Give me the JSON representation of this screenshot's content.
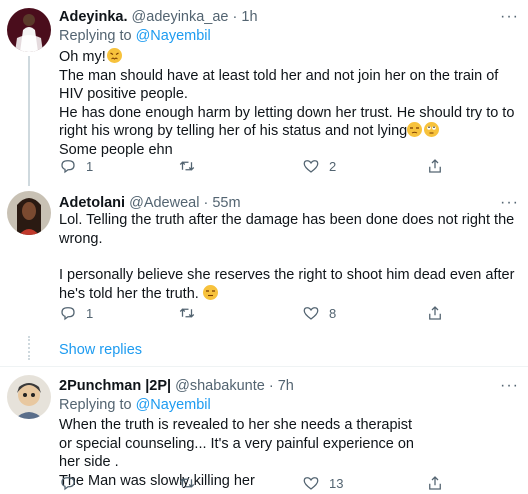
{
  "tweets": [
    {
      "name": "Adeyinka.",
      "handle": "@adeyinka_ae",
      "time": "1h",
      "reply_prefix": "Replying to",
      "reply_to": "@Nayembil",
      "lines": [
        "Oh my!",
        "The man should have at least told her and not join her on the train of HIV positive people.",
        "He has done enough harm by letting down her trust. He should try to to right his wrong by telling her of his status and not lying",
        "Some people ehn"
      ],
      "replies": "1",
      "retweets": "",
      "likes": "2",
      "avatar_icon": "profile-photo-woman-white-dress",
      "emoji": [
        "confounded-face-emoji",
        "unamused-face-emoji",
        "face-with-rolling-eyes-emoji"
      ]
    },
    {
      "name": "Adetolani",
      "handle": "@Adeweal",
      "time": "55m",
      "lines": [
        "Lol. Telling the truth after the damage has been done does not right the wrong.",
        "I personally believe she reserves the right to shoot him dead even after he's told her the truth."
      ],
      "replies": "1",
      "retweets": "",
      "likes": "8",
      "avatar_icon": "profile-photo-woman-braids",
      "emoji": [
        "expressionless-face-emoji"
      ]
    },
    {
      "name": "2Punchman |2P|",
      "handle": "@shabakunte",
      "time": "7h",
      "reply_prefix": "Replying to",
      "reply_to": "@Nayembil",
      "lines": [
        "When the truth is revealed to her she needs a therapist or special counseling... It's a very painful experience on her side .",
        "The Man was slowly killing her"
      ],
      "replies": "",
      "retweets": "",
      "likes": "13",
      "avatar_icon": "profile-photo-cartoon-character"
    }
  ],
  "show_replies_label": "Show replies",
  "separator": "·",
  "more_glyph": "···",
  "colors": {
    "text": "#0f1419",
    "secondary": "#536471",
    "link": "#1d9bf0",
    "divider": "#eff3f4",
    "thread_line": "#cfd9de"
  },
  "icons": [
    "reply-icon",
    "retweet-icon",
    "like-icon",
    "share-icon",
    "more-icon"
  ]
}
